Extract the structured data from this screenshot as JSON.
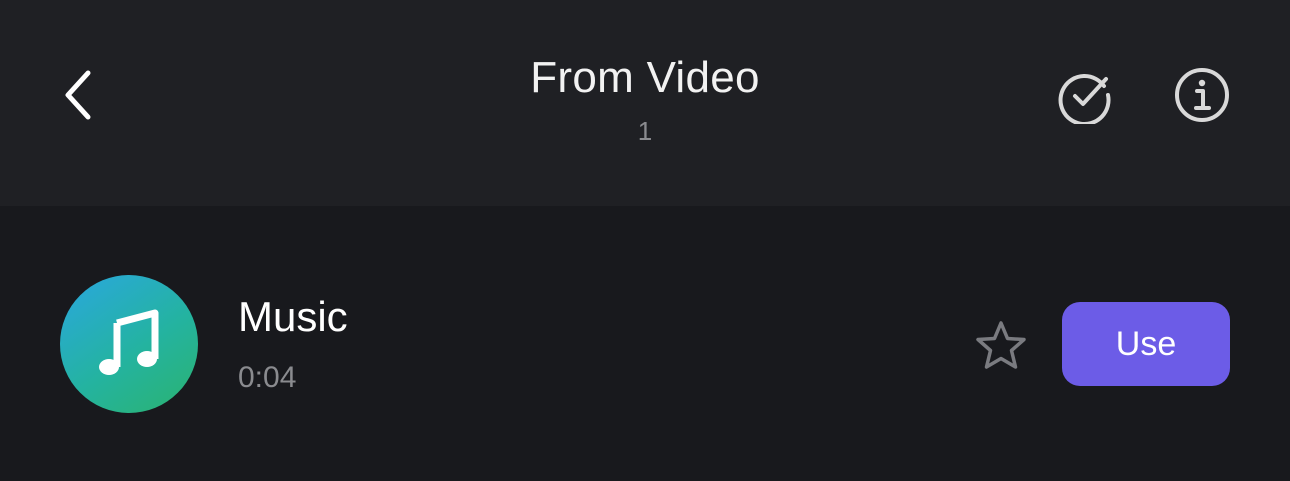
{
  "header": {
    "title": "From Video",
    "subtitle": "1",
    "back_icon": "chevron-left-icon",
    "select_icon": "circle-check-icon",
    "info_icon": "info-icon"
  },
  "track": {
    "name": "Music",
    "duration": "0:04",
    "thumbnail_icon": "music-note-icon",
    "favorite_icon": "star-outline-icon",
    "use_label": "Use"
  },
  "colors": {
    "background": "#18191d",
    "header_background": "#1f2024",
    "accent": "#6c5ce7",
    "secondary_text": "#8a8b8f",
    "thumbnail_gradient": [
      "#2aa7e0",
      "#2bb36f"
    ]
  }
}
